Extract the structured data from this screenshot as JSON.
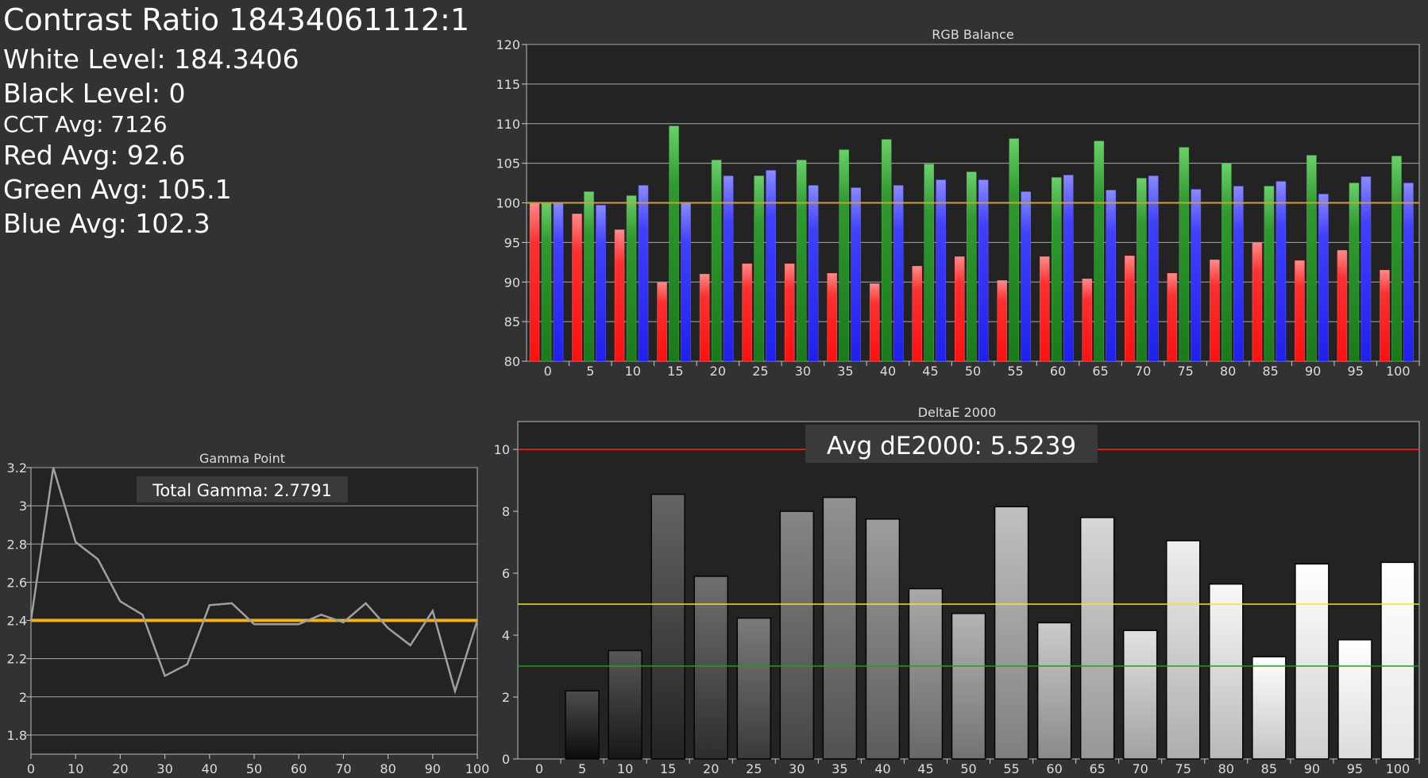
{
  "stats": {
    "contrast": "Contrast Ratio 18434061112:1",
    "white": "White Level: 184.3406",
    "black": "Black Level: 0",
    "cct": "CCT Avg: 7126",
    "red": "Red Avg: 92.6",
    "green": "Green Avg: 105.1",
    "blue": "Blue Avg: 102.3"
  },
  "colors": {
    "background": "#323232",
    "plot_bg": "#232323",
    "grid": "#a8a8a8",
    "red_bar": "#ff2a2a",
    "green_bar": "#2a9a2a",
    "blue_bar": "#3a3aff",
    "reference_line": "#c8a040",
    "gamma_line": "#f0b020",
    "gamma_curve": "#a0a0a0",
    "dE_red_line": "#ff2020",
    "dE_yellow_line": "#e8e820",
    "dE_green_line": "#20a020"
  },
  "chart_data": [
    {
      "type": "bar",
      "title": "RGB Balance",
      "categories": [
        "0",
        "5",
        "10",
        "15",
        "20",
        "25",
        "30",
        "35",
        "40",
        "45",
        "50",
        "55",
        "60",
        "65",
        "70",
        "75",
        "80",
        "85",
        "90",
        "95",
        "100"
      ],
      "series": [
        {
          "name": "Red",
          "values": [
            100,
            98.6,
            96.6,
            90.0,
            91.0,
            92.3,
            92.3,
            91.1,
            89.8,
            92.0,
            93.2,
            90.2,
            93.2,
            90.4,
            93.3,
            91.1,
            92.8,
            95.0,
            92.7,
            94.0,
            91.5
          ]
        },
        {
          "name": "Green",
          "values": [
            100,
            101.4,
            100.9,
            109.7,
            105.4,
            103.4,
            105.4,
            106.7,
            108.0,
            104.9,
            103.9,
            108.1,
            103.2,
            107.8,
            103.1,
            107.0,
            105.0,
            102.1,
            106.0,
            102.5,
            105.9
          ]
        },
        {
          "name": "Blue",
          "values": [
            100,
            99.7,
            102.2,
            100.0,
            103.4,
            104.1,
            102.2,
            101.9,
            102.2,
            102.9,
            102.9,
            101.4,
            103.5,
            101.6,
            103.4,
            101.7,
            102.1,
            102.7,
            101.1,
            103.3,
            102.5
          ]
        }
      ],
      "reference": 100,
      "ylim": [
        80,
        120
      ],
      "yticks": [
        80,
        85,
        90,
        95,
        100,
        105,
        110,
        115,
        120
      ],
      "grid": true
    },
    {
      "type": "bar",
      "title": "DeltaE 2000",
      "annotation": "Avg dE2000: 5.5239",
      "categories": [
        "0",
        "5",
        "10",
        "15",
        "20",
        "25",
        "30",
        "35",
        "40",
        "45",
        "50",
        "55",
        "60",
        "65",
        "70",
        "75",
        "80",
        "85",
        "90",
        "95",
        "100"
      ],
      "values": [
        0,
        2.2,
        3.5,
        8.55,
        5.9,
        4.55,
        8.0,
        8.45,
        7.75,
        5.5,
        4.7,
        8.15,
        4.4,
        7.8,
        4.15,
        7.05,
        5.65,
        3.3,
        6.3,
        3.85,
        6.35
      ],
      "thresholds": [
        10,
        5,
        3
      ],
      "ylim": [
        0,
        10.9
      ],
      "yticks": [
        0,
        2,
        4,
        6,
        8,
        10
      ],
      "grid": false
    },
    {
      "type": "line",
      "title": "Gamma Point",
      "annotation": "Total Gamma: 2.7791",
      "x": [
        0,
        5,
        10,
        15,
        20,
        25,
        30,
        35,
        40,
        45,
        50,
        55,
        60,
        65,
        70,
        75,
        80,
        85,
        90,
        95,
        100
      ],
      "y": [
        2.4,
        3.2,
        2.81,
        2.72,
        2.5,
        2.43,
        2.11,
        2.17,
        2.48,
        2.49,
        2.38,
        2.38,
        2.38,
        2.43,
        2.39,
        2.49,
        2.36,
        2.27,
        2.45,
        2.03,
        2.4
      ],
      "reference": 2.4,
      "xticks": [
        0,
        10,
        20,
        30,
        40,
        50,
        60,
        70,
        80,
        90,
        100
      ],
      "yticks": [
        "1.8",
        "2",
        "2.2",
        "2.4",
        "2.6",
        "2.8",
        "3",
        "3.2"
      ],
      "xlim": [
        0,
        100
      ],
      "ylim": [
        1.7,
        3.2
      ],
      "grid": true
    }
  ]
}
